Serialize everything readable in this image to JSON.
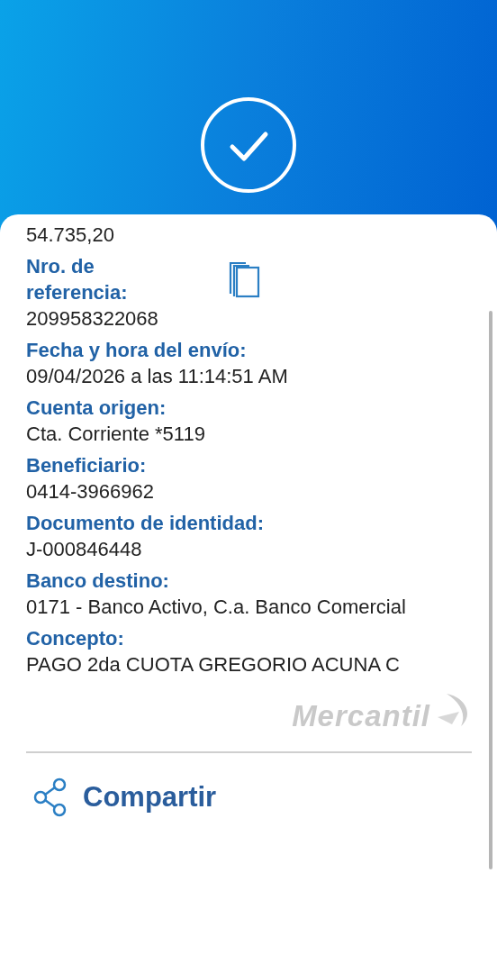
{
  "fields": [
    {
      "value": "54.735,20"
    },
    {
      "label": "Nro. de referencia:",
      "value": "209958322068",
      "copyable": true
    },
    {
      "label": "Fecha y hora del envío:",
      "value": "09/04/2026 a las 11:14:51 AM"
    },
    {
      "label": "Cuenta origen:",
      "value": "Cta. Corriente *5119"
    },
    {
      "label": "Beneficiario:",
      "value": "0414-3966962"
    },
    {
      "label": "Documento de identidad:",
      "value": "J-000846448"
    },
    {
      "label": "Banco destino:",
      "value": "0171 - Banco Activo, C.a. Banco Comercial"
    },
    {
      "label": "Concepto:",
      "value": "PAGO 2da CUOTA GREGORIO ACUNA C"
    }
  ],
  "brand": "Mercantil",
  "share_button": "Compartir"
}
